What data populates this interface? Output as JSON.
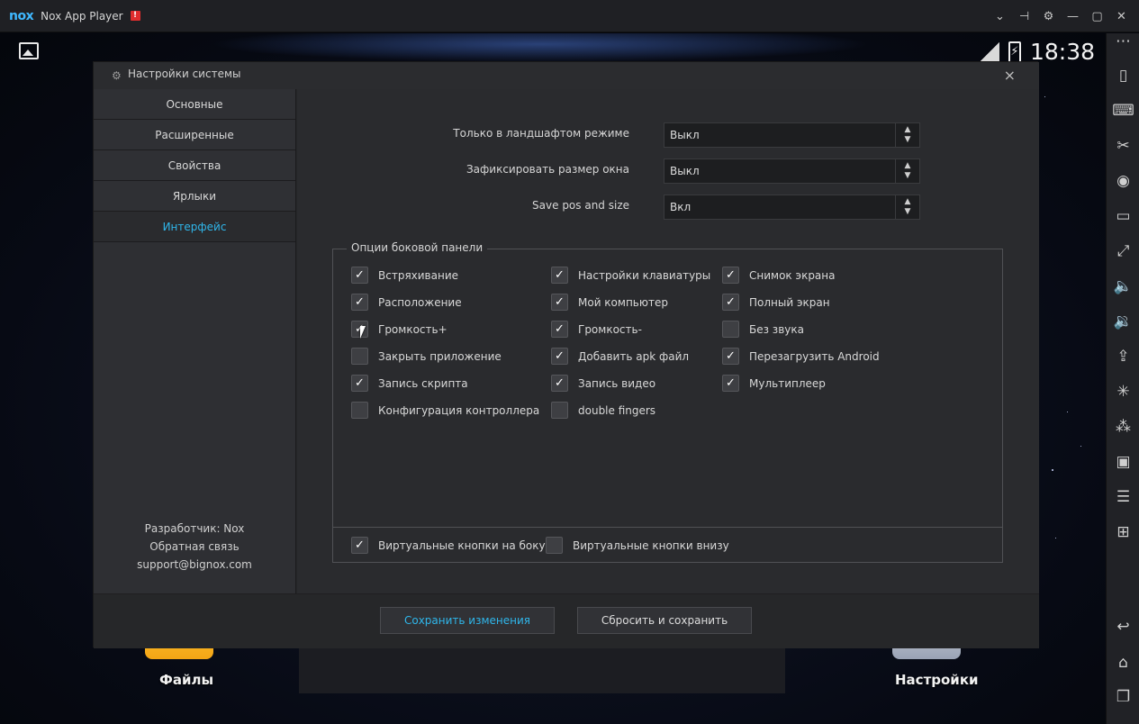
{
  "window": {
    "logo": "nox",
    "title": "Nox App Player",
    "alert": "!",
    "controls": [
      "chevron-down-icon",
      "pin-icon",
      "gear-icon",
      "minimize-icon",
      "maximize-icon",
      "close-icon"
    ]
  },
  "statusbar": {
    "time": "18:38"
  },
  "dialog": {
    "title": "Настройки системы",
    "close": "×"
  },
  "nav": {
    "items": [
      {
        "label": "Основные"
      },
      {
        "label": "Расширенные"
      },
      {
        "label": "Свойства"
      },
      {
        "label": "Ярлыки"
      },
      {
        "label": "Интерфейс",
        "active": true
      }
    ],
    "footer": {
      "developer": "Разработчик: Nox",
      "feedback": "Обратная связь",
      "email": "support@bignox.com"
    }
  },
  "settings": {
    "landscape_label": "Только в ландшафтом режиме",
    "landscape_value": "Выкл",
    "fix_size_label": "Зафиксировать размер окна",
    "fix_size_value": "Выкл",
    "save_pos_label": "Save pos and size",
    "save_pos_value": "Вкл"
  },
  "sidebar_options": {
    "legend": "Опции боковой панели",
    "columns": [
      [
        {
          "label": "Встряхивание",
          "checked": true
        },
        {
          "label": "Расположение",
          "checked": true
        },
        {
          "label": "Громкость+",
          "checked": true
        },
        {
          "label": "Закрыть приложение",
          "checked": false
        },
        {
          "label": "Запись скрипта",
          "checked": true
        },
        {
          "label": "Конфигурация контроллера",
          "checked": false
        }
      ],
      [
        {
          "label": "Настройки клавиатуры",
          "checked": true
        },
        {
          "label": "Мой компьютер",
          "checked": true
        },
        {
          "label": "Громкость-",
          "checked": true
        },
        {
          "label": "Добавить apk файл",
          "checked": true
        },
        {
          "label": "Запись видео",
          "checked": true
        },
        {
          "label": "double fingers",
          "checked": false
        }
      ],
      [
        {
          "label": "Снимок экрана",
          "checked": true
        },
        {
          "label": "Полный экран",
          "checked": true
        },
        {
          "label": "Без звука",
          "checked": false
        },
        {
          "label": "Перезагрузить Android",
          "checked": true
        },
        {
          "label": "Мультиплеер",
          "checked": true
        }
      ]
    ],
    "virtual_side": {
      "label": "Виртуальные кнопки на боку",
      "checked": true
    },
    "virtual_bottom": {
      "label": "Виртуальные кнопки внизу",
      "checked": false
    }
  },
  "buttons": {
    "save": "Сохранить изменения",
    "reset": "Сбросить и сохранить"
  },
  "dock": {
    "files": "Файлы",
    "settings": "Настройки"
  },
  "colors": {
    "accent": "#2fb6ea",
    "alert": "#e02d2d"
  }
}
